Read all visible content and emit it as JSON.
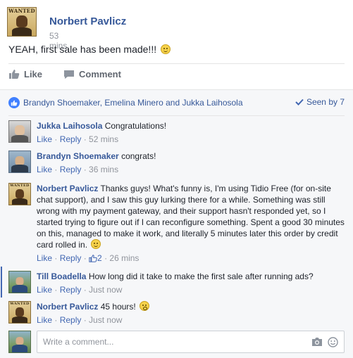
{
  "post": {
    "author": "Norbert Pavlicz",
    "time": "53 mins",
    "text": "YEAH, first sale has been made!!!",
    "avatar_wanted": "WANTED"
  },
  "actions": {
    "like": "Like",
    "comment": "Comment"
  },
  "likers": {
    "text": "Brandyn Shoemaker, Emelina Minero and Jukka Laihosola",
    "seen_by": "Seen by 7"
  },
  "comments": [
    {
      "author": "Jukka Laihosola",
      "text": "Congratulations!",
      "like": "Like",
      "reply": "Reply",
      "time": "52 mins"
    },
    {
      "author": "Brandyn Shoemaker",
      "text": "congrats!",
      "like": "Like",
      "reply": "Reply",
      "time": "36 mins"
    },
    {
      "author": "Norbert Pavlicz",
      "text": "Thanks guys! What's funny is, I'm using Tidio Free (for on-site chat support), and I saw this guy lurking there for a while. Something was still wrong with my payment gateway, and their support hasn't responded yet, so I started trying to figure out if I can reconfigure something. Spent a good 30 minutes on this, managed to make it work, and literally 5 minutes later this order by credit card rolled in.",
      "like": "Like",
      "reply": "Reply",
      "likes": "2",
      "time": "26 mins"
    },
    {
      "author": "Till Boadella",
      "text": "How long did it take to make the first sale after running ads?",
      "like": "Like",
      "reply": "Reply",
      "time": "Just now"
    },
    {
      "author": "Norbert Pavlicz",
      "text": "45 hours!",
      "like": "Like",
      "reply": "Reply",
      "time": "Just now"
    }
  ],
  "reply_box": {
    "placeholder": "Write a comment..."
  },
  "colors": {
    "link": "#365899",
    "muted": "#90949c",
    "accent": "#4267b2",
    "like_badge": "#4080ff"
  }
}
